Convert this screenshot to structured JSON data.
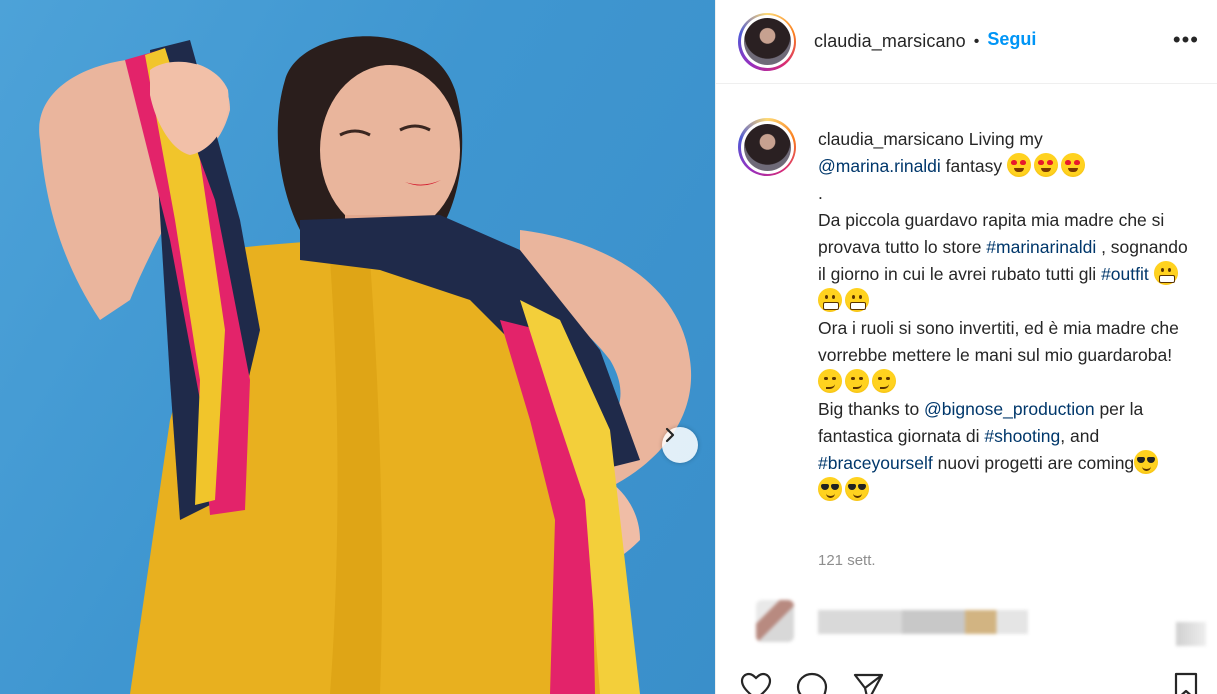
{
  "post": {
    "username": "claudia_marsicano",
    "separator": "•",
    "follow_label": "Segui",
    "more_label": "•••",
    "timestamp": "121 sett."
  },
  "caption": {
    "username": "claudia_marsicano",
    "t1": " Living my ",
    "mention1": "@marina.rinaldi",
    "t2": " fantasy ",
    "dot": ".",
    "t3": "Da piccola guardavo rapita mia madre che si provava tutto lo store ",
    "hashtag1": "#marinarinaldi",
    "t4": " , sognando il giorno in cui le avrei rubato tutti gli ",
    "hashtag2": "#outfit",
    "t5": "Ora i ruoli si sono invertiti, ed è mia madre che vorrebbe mettere le mani sul mio guardaroba!",
    "t6": "Big thanks to ",
    "mention2": "@bignose_production",
    "t7": " per la fantastica giornata di ",
    "hashtag3": "#shooting",
    "t8": ", and ",
    "hashtag4": "#braceyourself",
    "t9": " nuovi progetti are coming"
  },
  "icons": {
    "next": "chevron-right-icon",
    "like": "heart-icon",
    "comment": "comment-icon",
    "share": "paper-plane-icon",
    "save": "bookmark-icon"
  },
  "colors": {
    "follow": "#0095f6",
    "link": "#00376b",
    "muted": "#8e8e8e",
    "background_photo": "#3f96d0"
  }
}
